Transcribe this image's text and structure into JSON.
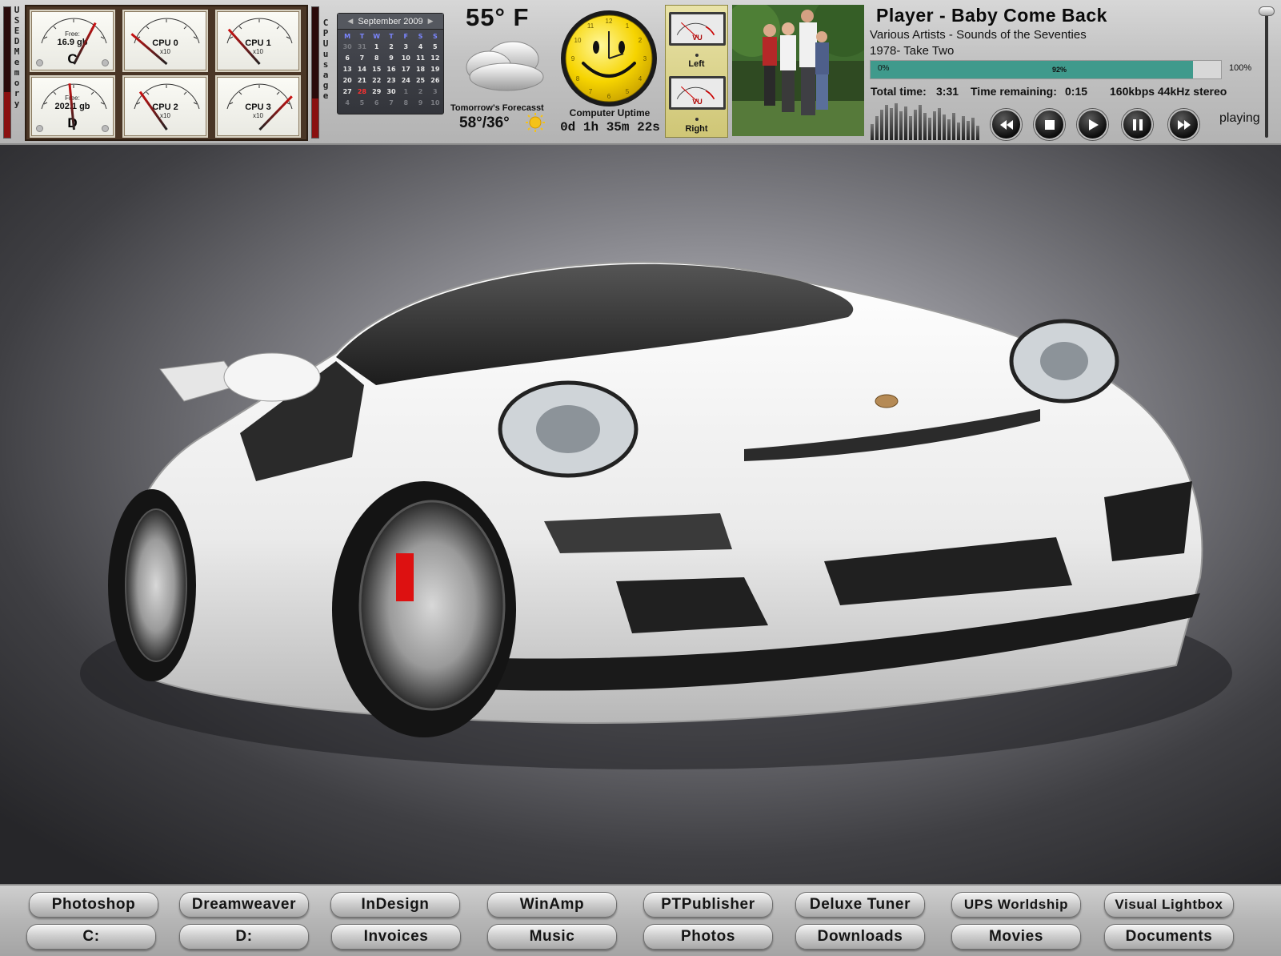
{
  "memory_gauges": {
    "side_label": "USED Memory",
    "c_drive": {
      "free_label": "Free:",
      "free_value": "16.9 gb",
      "letter": "C",
      "level": 0.75
    },
    "d_drive": {
      "free_label": "Free:",
      "free_value": "202.1 gb",
      "letter": "D",
      "level": 0.45
    }
  },
  "cpu_gauges": {
    "side_label": "CPU usage",
    "multiplier": "x10",
    "cpu0": {
      "label": "CPU 0",
      "level": 0.05
    },
    "cpu1": {
      "label": "CPU 1",
      "level": 0.12
    },
    "cpu2": {
      "label": "CPU 2",
      "level": 0.18
    },
    "cpu3": {
      "label": "CPU 3",
      "level": 0.9
    }
  },
  "calendar": {
    "month_label": "September 2009",
    "weekdays": [
      "M",
      "T",
      "W",
      "T",
      "F",
      "S",
      "S"
    ],
    "weeks": [
      [
        "30",
        "31",
        "1",
        "2",
        "3",
        "4",
        "5"
      ],
      [
        "6",
        "7",
        "8",
        "9",
        "10",
        "11",
        "12"
      ],
      [
        "13",
        "14",
        "15",
        "16",
        "17",
        "18",
        "19"
      ],
      [
        "20",
        "21",
        "22",
        "23",
        "24",
        "25",
        "26"
      ],
      [
        "27",
        "28",
        "29",
        "30",
        "1",
        "2",
        "3"
      ],
      [
        "4",
        "5",
        "6",
        "7",
        "8",
        "9",
        "10"
      ]
    ],
    "today": "28"
  },
  "weather": {
    "current_temp": "55° F",
    "forecast_label": "Tomorrow's Forecasst",
    "forecast_value": "58°/36°"
  },
  "clock": {
    "uptime_label": "Computer Uptime",
    "uptime_value": "0d 1h 35m 22s"
  },
  "vu_meters": {
    "meter_text": "VU",
    "left_label": "Left",
    "right_label": "Right"
  },
  "player": {
    "title": "Player - Baby Come Back",
    "artist_album": "Various Artists - Sounds of the Seventies",
    "track": "1978- Take Two",
    "progress_start": "0%",
    "progress_value": "92%",
    "progress_fraction": 0.92,
    "progress_end": "100%",
    "total_time_label": "Total time:",
    "total_time": "3:31",
    "time_remaining_label": "Time remaining:",
    "time_remaining": "0:15",
    "bitrate_info": "160kbps 44kHz stereo",
    "status": "playing"
  },
  "dock": {
    "row1": [
      "Photoshop",
      "Dreamweaver",
      "InDesign",
      "WinAmp",
      "PTPublisher",
      "Deluxe Tuner",
      "UPS Worldship",
      "Visual Lightbox"
    ],
    "row2": [
      "C:",
      "D:",
      "Invoices",
      "Music",
      "Photos",
      "Downloads",
      "Movies",
      "Documents"
    ]
  },
  "colors": {
    "progress_fill": "#3f9a8c",
    "needle_red": "#cc1111",
    "gauge_frame": "#4a3626"
  }
}
